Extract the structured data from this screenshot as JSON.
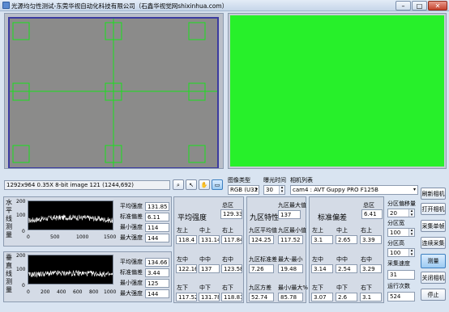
{
  "window": {
    "title": "光源均匀性测试-东莞华视自动化科技有限公司（石鑫华视觉网shixinhua.com）"
  },
  "camera_view": {
    "status": "1292x964 0.35X 8-bit image 121   (1244,692)"
  },
  "controls": {
    "image_type_label": "图像类型",
    "image_type_value": "RGB (U32)",
    "exposure_label": "曝光时间",
    "exposure_value": "30",
    "camera_list_label": "相机列表",
    "camera_value": "cam4 : AVT Guppy PRO F125B"
  },
  "buttons": {
    "refresh": "刷新相机",
    "open": "打开相机",
    "single": "采集单帧",
    "continuous": "连续采集",
    "measure": "测量",
    "close_cam": "关闭相机",
    "stop": "停止"
  },
  "partition": {
    "offset_label": "分区偏移量",
    "offset_value": "20",
    "width_label": "分区宽",
    "width_value": "100",
    "height_label": "分区高",
    "height_value": "100",
    "speed_label": "采集速度",
    "speed_value": "31",
    "runs_label": "运行次数",
    "runs_value": "524"
  },
  "h_profile": {
    "title": "水平线测量",
    "ticks": [
      "200",
      "100",
      "0",
      "0",
      "500",
      "1000",
      "1500"
    ],
    "stats": [
      {
        "label": "平均强度",
        "value": "131.85"
      },
      {
        "label": "标准偏差",
        "value": "6.11"
      },
      {
        "label": "最小强度",
        "value": "114"
      },
      {
        "label": "最大强度",
        "value": "144"
      }
    ]
  },
  "v_profile": {
    "title": "垂直线测量",
    "ticks": [
      "200",
      "100",
      "0",
      "0",
      "200",
      "400",
      "600",
      "800",
      "1000"
    ],
    "stats": [
      {
        "label": "平均强度",
        "value": "134.66"
      },
      {
        "label": "标准偏差",
        "value": "3.44"
      },
      {
        "label": "最小强度",
        "value": "125"
      },
      {
        "label": "最大强度",
        "value": "144"
      }
    ]
  },
  "avg": {
    "title": "平均强度",
    "total_label": "总区",
    "total": "129.33",
    "labels": [
      "左上",
      "中上",
      "右上",
      "左中",
      "中中",
      "右中",
      "左下",
      "中下",
      "右下"
    ],
    "values": [
      "118.4",
      "131.14",
      "117.84",
      "122.16",
      "137",
      "123.58",
      "117.52",
      "131.78",
      "118.81"
    ]
  },
  "nine": {
    "title": "九区特性",
    "max_label": "九区最大值",
    "max": "137",
    "mean_label": "九区平均值",
    "mean": "124.25",
    "min_label": "九区最小值",
    "min": "117.52",
    "std_label": "九区标准差",
    "std": "7.26",
    "range_label": "最大-最小",
    "range": "19.48",
    "var_label": "九区方差",
    "var": "52.74",
    "ratio_label": "最小/最大%",
    "ratio": "85.78"
  },
  "std": {
    "title": "标准偏差",
    "total_label": "总区",
    "total": "6.41",
    "labels": [
      "左上",
      "中上",
      "右上",
      "左中",
      "中中",
      "右中",
      "左下",
      "中下",
      "右下"
    ],
    "values": [
      "3.1",
      "2.65",
      "3.39",
      "3.14",
      "2.54",
      "3.29",
      "3.07",
      "2.6",
      "3.1"
    ]
  },
  "colors": {
    "accent": "#27f02a",
    "frame": "#3b3ba0",
    "grid": "#16e21a",
    "camera_gray": "#8a8a88"
  }
}
